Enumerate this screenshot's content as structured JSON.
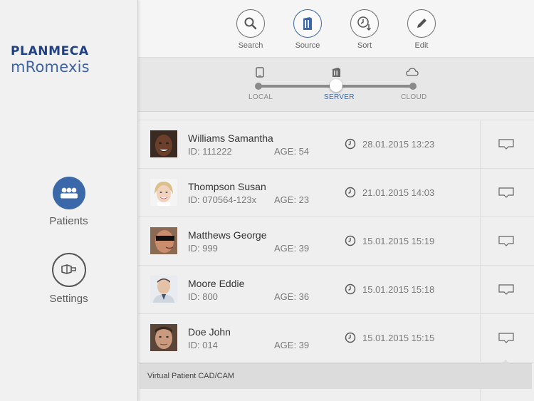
{
  "brand": {
    "line1": "PLANMECA",
    "line2": "mRomexis"
  },
  "nav": {
    "patients": {
      "label": "Patients",
      "icon": "patients-icon"
    },
    "settings": {
      "label": "Settings",
      "icon": "settings-icon"
    }
  },
  "toolbar": {
    "search": {
      "label": "Search",
      "icon": "search-icon"
    },
    "source": {
      "label": "Source",
      "icon": "server-icon"
    },
    "sort": {
      "label": "Sort",
      "icon": "clock-sort-icon"
    },
    "edit": {
      "label": "Edit",
      "icon": "pencil-icon"
    }
  },
  "source_selector": {
    "options": [
      "LOCAL",
      "SERVER",
      "CLOUD"
    ],
    "selected": "SERVER"
  },
  "patients": [
    {
      "name": "Williams Samantha",
      "id": "ID: 111222",
      "age": "AGE: 54",
      "date": "28.01.2015 13:23"
    },
    {
      "name": "Thompson Susan",
      "id": "ID: 070564-123x",
      "age": "AGE: 23",
      "date": "21.01.2015 14:03"
    },
    {
      "name": "Matthews George",
      "id": "ID: 999",
      "age": "AGE: 39",
      "date": "15.01.2015 15:19"
    },
    {
      "name": "Moore Eddie",
      "id": "ID: 800",
      "age": "AGE: 36",
      "date": "15.01.2015 15:18"
    },
    {
      "name": "Doe John",
      "id": "ID: 014",
      "age": "AGE: 39",
      "date": "15.01.2015 15:15"
    }
  ],
  "tooltip": {
    "text": "Virtual Patient CAD/CAM"
  },
  "colors": {
    "accent": "#3a68a8",
    "brand_dark": "#1f3f86"
  }
}
